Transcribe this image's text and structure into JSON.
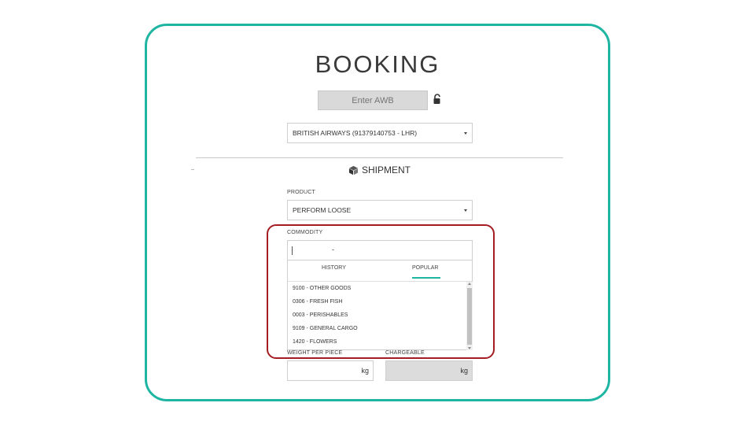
{
  "page": {
    "title": "BOOKING",
    "accent_color": "#1fb5a3",
    "highlight_color": "#a31d22"
  },
  "awb": {
    "placeholder": "Enter AWB",
    "lock_icon": "unlocked-padlock-icon"
  },
  "airline_select": {
    "value": "BRITISH AIRWAYS (91379140753 - LHR)"
  },
  "shipment": {
    "heading": "SHIPMENT",
    "icon": "package-box-icon",
    "product": {
      "label": "PRODUCT",
      "value": "PERFORM LOOSE"
    },
    "commodity": {
      "label": "COMMODITY",
      "value": "-",
      "tabs": [
        {
          "label": "HISTORY",
          "active": false
        },
        {
          "label": "POPULAR",
          "active": true
        }
      ],
      "options": [
        "9100 - OTHER GOODS",
        "0306 - FRESH FISH",
        "0003 - PERISHABLES",
        "9109 - GENERAL CARGO",
        "1420 - FLOWERS"
      ]
    },
    "weight_per_piece": {
      "label": "WEIGHT PER PIECE",
      "unit": "kg"
    },
    "chargeable": {
      "label": "CHARGEABLE",
      "unit": "kg"
    }
  }
}
